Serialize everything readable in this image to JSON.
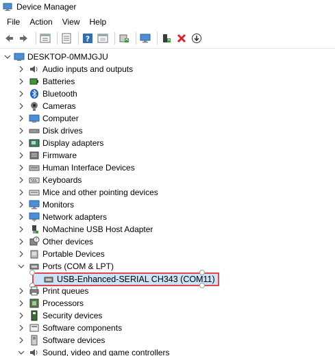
{
  "window": {
    "title": "Device Manager"
  },
  "menu": [
    "File",
    "Action",
    "View",
    "Help"
  ],
  "toolbar": {
    "buttons": [
      "back-icon",
      "forward-icon",
      "properties-icon",
      "refresh-icon",
      "help-icon",
      "show-hidden-icon",
      "scan-hardware-icon",
      "monitor-icon",
      "add-driver-icon",
      "uninstall-icon",
      "download-icon"
    ]
  },
  "tree": {
    "root": "DESKTOP-0MMJGJU",
    "categories": [
      {
        "label": "Audio inputs and outputs",
        "icon": "audio-icon"
      },
      {
        "label": "Batteries",
        "icon": "battery-icon"
      },
      {
        "label": "Bluetooth",
        "icon": "bluetooth-icon"
      },
      {
        "label": "Cameras",
        "icon": "camera-icon"
      },
      {
        "label": "Computer",
        "icon": "computer-icon"
      },
      {
        "label": "Disk drives",
        "icon": "disk-icon"
      },
      {
        "label": "Display adapters",
        "icon": "display-adapter-icon"
      },
      {
        "label": "Firmware",
        "icon": "firmware-icon"
      },
      {
        "label": "Human Interface Devices",
        "icon": "hid-icon"
      },
      {
        "label": "Keyboards",
        "icon": "keyboard-icon"
      },
      {
        "label": "Mice and other pointing devices",
        "icon": "mouse-icon"
      },
      {
        "label": "Monitors",
        "icon": "monitor-icon"
      },
      {
        "label": "Network adapters",
        "icon": "network-icon"
      },
      {
        "label": "NoMachine USB Host Adapter",
        "icon": "usb-host-icon"
      },
      {
        "label": "Other devices",
        "icon": "other-devices-icon"
      },
      {
        "label": "Portable Devices",
        "icon": "portable-icon"
      },
      {
        "label": "Ports (COM & LPT)",
        "icon": "port-icon",
        "expanded": true
      },
      {
        "label": "Print queues",
        "icon": "printer-icon"
      },
      {
        "label": "Processors",
        "icon": "processor-icon"
      },
      {
        "label": "Security devices",
        "icon": "security-icon"
      },
      {
        "label": "Software components",
        "icon": "software-component-icon"
      },
      {
        "label": "Software devices",
        "icon": "software-device-icon"
      },
      {
        "label": "Sound, video and game controllers",
        "icon": "sound-icon",
        "expanded": true
      }
    ],
    "ports_child": "USB-Enhanced-SERIAL CH343 (COM11)"
  }
}
